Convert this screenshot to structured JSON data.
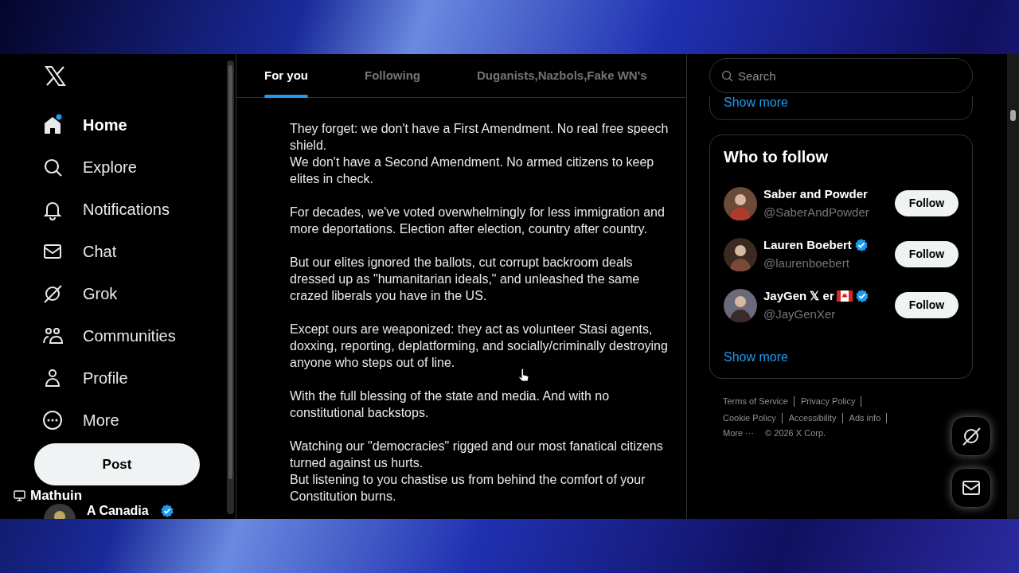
{
  "sidebar": {
    "items": [
      {
        "label": "Home",
        "selected": true,
        "badge": true
      },
      {
        "label": "Explore",
        "selected": false,
        "badge": false
      },
      {
        "label": "Notifications",
        "selected": false,
        "badge": false
      },
      {
        "label": "Chat",
        "selected": false,
        "badge": false
      },
      {
        "label": "Grok",
        "selected": false,
        "badge": false
      },
      {
        "label": "Communities",
        "selected": false,
        "badge": false
      },
      {
        "label": "Profile",
        "selected": false,
        "badge": false
      },
      {
        "label": "More",
        "selected": false,
        "badge": false
      }
    ],
    "post_button": "Post",
    "overlay_label": "Mathuin",
    "account": {
      "name": "A Canadia",
      "verified": true
    }
  },
  "tabs": [
    {
      "label": "For you",
      "selected": true
    },
    {
      "label": "Following",
      "selected": false
    },
    {
      "label": "Duganists,Nazbols,Fake WN's",
      "selected": false
    }
  ],
  "post": {
    "paragraphs": [
      "They forget: we don't have a First Amendment. No real free speech shield.\nWe don't have a Second Amendment. No armed citizens to keep elites in check.",
      "For decades, we've voted overwhelmingly for less immigration and more deportations. Election after election, country after country.",
      "But our elites ignored the ballots, cut corrupt backroom deals dressed up as \"humanitarian ideals,\" and unleashed the same crazed liberals you have in the US.",
      "Except ours are weaponized: they act as volunteer Stasi agents, doxxing, reporting, deplatforming, and socially/criminally destroying anyone who steps out of line.",
      "With the full blessing of the state and media. And with no constitutional backstops.",
      "Watching our \"democracies\" rigged and our most fanatical citizens turned against us hurts.\nBut listening to you chastise us from behind the comfort of your Constitution burns."
    ]
  },
  "search": {
    "placeholder": "Search"
  },
  "trends": {
    "show_more": "Show more"
  },
  "who_to_follow": {
    "title": "Who to follow",
    "users": [
      {
        "name": "Saber and Powder",
        "handle": "@SaberAndPowder",
        "verified": false,
        "flag": false,
        "button": "Follow"
      },
      {
        "name": "Lauren Boebert",
        "handle": "@laurenboebert",
        "verified": true,
        "flag": false,
        "button": "Follow"
      },
      {
        "name": "JayGen 𝕏 er",
        "handle": "@JayGenXer",
        "verified": true,
        "flag": true,
        "button": "Follow"
      }
    ],
    "show_more": "Show more"
  },
  "footer": {
    "rows": [
      [
        "Terms of Service",
        "Privacy Policy"
      ],
      [
        "Cookie Policy",
        "Accessibility",
        "Ads info"
      ]
    ],
    "more": "More ···",
    "copyright": "© 2026 X Corp."
  }
}
